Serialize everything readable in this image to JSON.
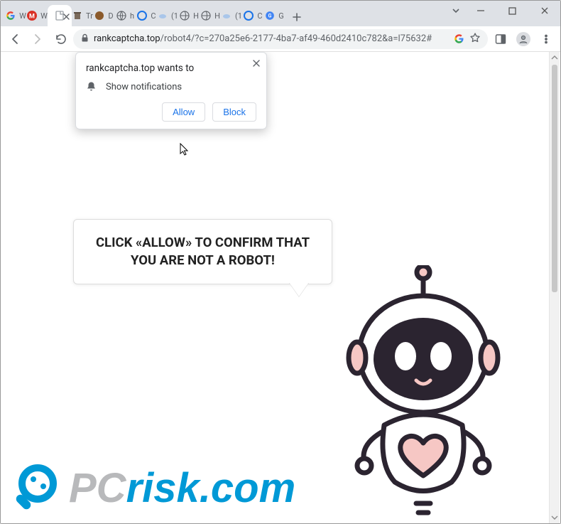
{
  "tabs": [
    {
      "label": "W",
      "icon": "g-logo"
    },
    {
      "label": "W",
      "icon": "red-m"
    },
    {
      "label": "",
      "icon": "page",
      "active": true
    },
    {
      "label": "Tr",
      "icon": "trash"
    },
    {
      "label": "D",
      "icon": "brown"
    },
    {
      "label": "h",
      "icon": "globe"
    },
    {
      "label": "C",
      "icon": "c-blue"
    },
    {
      "label": "(1",
      "icon": "cloud"
    },
    {
      "label": "H",
      "icon": "globe"
    },
    {
      "label": "H",
      "icon": "globe"
    },
    {
      "label": "(1",
      "icon": "cloud"
    },
    {
      "label": "C",
      "icon": "c-blue"
    },
    {
      "label": "G",
      "icon": "g-logo"
    }
  ],
  "omnibox": {
    "domain": "rankcaptcha.top",
    "path": "/robot4/?c=270a25e6-2177-4ba7-af49-460d2410c782&a=l75632#"
  },
  "permission": {
    "title": "rankcaptcha.top wants to",
    "item": "Show notifications",
    "allow": "Allow",
    "block": "Block"
  },
  "bubble": {
    "text": "CLICK «ALLOW» TO CONFIRM THAT YOU ARE NOT A ROBOT!"
  },
  "watermark": {
    "text_pc": "PC",
    "text_rest": "risk.com"
  },
  "colors": {
    "robot_outline": "#2b2430",
    "robot_pink": "#f6c7c4",
    "watermark_gray": "#b8b9bb",
    "watermark_blue": "#0099d6"
  }
}
